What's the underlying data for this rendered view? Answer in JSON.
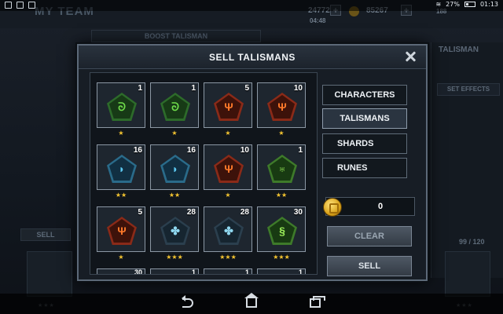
{
  "status_bar": {
    "battery": "27%",
    "time": "01:13"
  },
  "background": {
    "screen_title": "MY TEAM",
    "energy": "24772",
    "timer": "04:48",
    "gold": "85267",
    "gems": "188",
    "boost_button": "BOOST TALISMAN",
    "talisman_label": "TALISMAN",
    "set_effects": "SET EFFECTS",
    "sell_button": "SELL",
    "slot_count": "99 / 120"
  },
  "modal": {
    "title": "SELL TALISMANS",
    "items": [
      {
        "count": "1",
        "stars": "★",
        "color": "green",
        "glyph": "ᘐ"
      },
      {
        "count": "1",
        "stars": "★",
        "color": "green",
        "glyph": "ᘐ"
      },
      {
        "count": "5",
        "stars": "★",
        "color": "red",
        "glyph": "Ψ"
      },
      {
        "count": "10",
        "stars": "★",
        "color": "red",
        "glyph": "Ψ"
      },
      {
        "count": "16",
        "stars": "★★",
        "color": "blue",
        "glyph": "◗"
      },
      {
        "count": "16",
        "stars": "★★",
        "color": "blue",
        "glyph": "◗"
      },
      {
        "count": "10",
        "stars": "★",
        "color": "red",
        "glyph": "Ψ"
      },
      {
        "count": "1",
        "stars": "★★",
        "color": "lime",
        "glyph": "♅"
      },
      {
        "count": "5",
        "stars": "★",
        "color": "red",
        "glyph": "Ψ"
      },
      {
        "count": "28",
        "stars": "★★★",
        "color": "ice",
        "glyph": "✤"
      },
      {
        "count": "28",
        "stars": "★★★",
        "color": "ice",
        "glyph": "✤"
      },
      {
        "count": "30",
        "stars": "★★★",
        "color": "lime",
        "glyph": "§"
      }
    ],
    "partial_counts": [
      "30",
      "1",
      "1",
      "1"
    ],
    "tabs": {
      "characters": "CHARACTERS",
      "talismans": "TALISMANS",
      "shards": "SHARDS",
      "runes": "RUNES"
    },
    "gold_total": "0",
    "clear_label": "CLEAR",
    "sell_label": "SELL"
  }
}
